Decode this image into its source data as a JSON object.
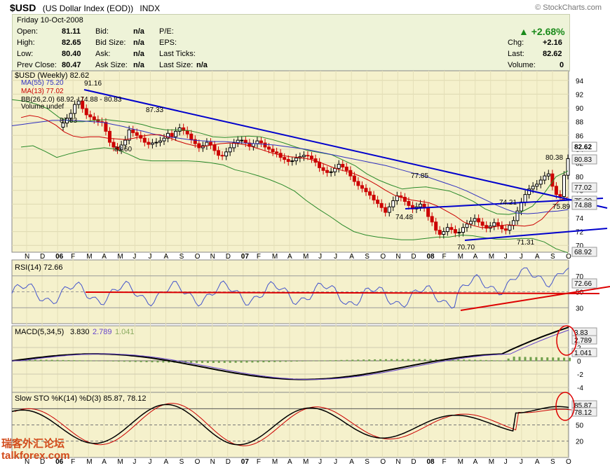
{
  "header": {
    "symbol": "$USD",
    "name": "(US Dollar Index (EOD))",
    "exchange": "INDX",
    "source": "© StockCharts.com"
  },
  "quote": {
    "date": "Friday  10-Oct-2008",
    "open_label": "Open:",
    "open": "81.11",
    "high_label": "High:",
    "high": "82.65",
    "low_label": "Low:",
    "low": "80.40",
    "prevclose_label": "Prev Close:",
    "prevclose": "80.47",
    "bid_label": "Bid:",
    "bid": "n/a",
    "bidsize_label": "Bid Size:",
    "bidsize": "n/a",
    "ask_label": "Ask:",
    "ask": "n/a",
    "asksize_label": "Ask Size:",
    "asksize": "n/a",
    "pe_label": "P/E:",
    "eps_label": "EPS:",
    "lastticks_label": "Last Ticks:",
    "lastsize_label": "Last Size:",
    "lastsize": "n/a",
    "pct": "+2.68%",
    "chg_label": "Chg:",
    "chg": "+2.16",
    "last_label": "Last:",
    "last": "82.62",
    "volume_label": "Volume:",
    "volume": "0"
  },
  "legend": {
    "price": "$USD (Weekly) 82.62",
    "ma55": "MA(55) 75.20",
    "ma13": "MA(13) 77.02",
    "bb": "BB(26,2.0) 68.92 - 74.88 - 80.83",
    "volume": "Volume undef",
    "rsi": "RSI(14) 72.66",
    "macd_prefix": "MACD(5,34,5)",
    "macd_a": "3.830",
    "macd_b": "2.789",
    "macd_c": "1.041",
    "sto": "Slow STO %K(14) %D(3) 85.87, 78.12"
  },
  "watermark": {
    "line1": "瑞客外汇论坛",
    "line2": "talkforex.com"
  },
  "colors": {
    "panel_bg": "#f5f1cc",
    "up": "#000000",
    "down": "#cc0000",
    "ma55": "#3030c0",
    "ma13": "#cc0000",
    "bb": "#2a8a2a",
    "trend": "#0000cc",
    "circle": "#dd0000"
  },
  "chart_data": [
    {
      "type": "candlestick",
      "title": "$USD (Weekly) 82.62",
      "x_months": [
        "N",
        "D",
        "06",
        "F",
        "M",
        "A",
        "M",
        "J",
        "J",
        "A",
        "S",
        "O",
        "N",
        "D",
        "07",
        "F",
        "M",
        "A",
        "M",
        "J",
        "J",
        "A",
        "S",
        "O",
        "N",
        "D",
        "08",
        "F",
        "M",
        "A",
        "M",
        "J",
        "J",
        "A",
        "S",
        "O"
      ],
      "y_ticks": [
        70,
        72,
        74,
        76,
        78,
        80,
        82,
        84,
        86,
        88,
        90,
        92,
        94
      ],
      "ylim": [
        69,
        95
      ],
      "annotations": [
        "91.16",
        "87.83",
        "87.33",
        "83.60",
        "77.85",
        "74.48",
        "74.21",
        "75.89",
        "80.38",
        "70.70",
        "71.31"
      ],
      "right_labels": [
        "82.62",
        "80.83",
        "77.02",
        "75.20",
        "74.88",
        "68.92"
      ],
      "close": [
        87.8,
        88.5,
        89.2,
        90.5,
        91.0,
        89.9,
        89.0,
        88.7,
        88.3,
        88.0,
        87.9,
        86.6,
        85.0,
        84.3,
        83.9,
        84.6,
        85.3,
        86.8,
        86.4,
        86.0,
        85.6,
        85.0,
        84.7,
        84.9,
        85.0,
        85.2,
        85.6,
        86.3,
        85.8,
        86.6,
        87.1,
        86.7,
        86.2,
        85.4,
        84.8,
        84.2,
        84.5,
        85.0,
        84.6,
        83.8,
        83.1,
        83.0,
        83.6,
        84.2,
        84.9,
        85.3,
        85.3,
        84.9,
        84.4,
        84.8,
        85.2,
        84.9,
        84.3,
        84.0,
        83.6,
        83.4,
        82.8,
        82.5,
        82.2,
        82.3,
        82.7,
        82.9,
        83.1,
        83.0,
        82.6,
        82.1,
        81.3,
        80.9,
        80.6,
        80.7,
        81.2,
        81.8,
        81.4,
        80.9,
        80.1,
        79.3,
        78.7,
        78.3,
        77.8,
        77.3,
        76.6,
        76.1,
        75.5,
        74.8,
        75.6,
        76.5,
        77.2,
        77.0,
        76.4,
        75.8,
        75.3,
        75.6,
        76.0,
        75.5,
        74.2,
        73.4,
        72.2,
        71.6,
        72.0,
        72.6,
        72.3,
        71.8,
        71.9,
        72.6,
        73.1,
        73.5,
        73.9,
        73.4,
        72.9,
        72.5,
        72.8,
        73.3,
        72.9,
        72.4,
        72.2,
        72.9,
        73.6,
        75.0,
        76.3,
        77.4,
        78.2,
        78.6,
        78.9,
        79.5,
        80.1,
        80.4,
        78.6,
        77.4,
        77.1,
        80.2,
        82.62
      ],
      "ma55": [
        87.4,
        87.6,
        87.8,
        88.0,
        88.2,
        88.2,
        88.2,
        88.1,
        88.0,
        87.9,
        87.6,
        87.3,
        86.9,
        86.6,
        86.2,
        85.9,
        85.7,
        85.5,
        85.3,
        85.2,
        85.1,
        85.1,
        85.0,
        84.9,
        84.8,
        84.7,
        84.6,
        84.4,
        84.2,
        84.0,
        83.7,
        83.4,
        83.1,
        82.8,
        82.5,
        82.2,
        81.9,
        81.6,
        81.2,
        80.8,
        80.4,
        80.0,
        79.5,
        79.0,
        78.5,
        77.9,
        77.2,
        76.5,
        75.8,
        75.2,
        74.7,
        74.6,
        74.7,
        74.9,
        75.0,
        75.2
      ],
      "ma13": [
        88.6,
        88.9,
        88.7,
        88.2,
        87.5,
        86.5,
        85.9,
        85.7,
        85.8,
        85.8,
        85.6,
        85.5,
        85.4,
        85.6,
        85.9,
        86.1,
        86.1,
        85.7,
        85.2,
        84.8,
        84.5,
        84.4,
        84.6,
        84.8,
        84.9,
        84.8,
        84.6,
        84.2,
        83.8,
        83.4,
        83.1,
        82.9,
        82.8,
        82.6,
        82.3,
        81.8,
        81.3,
        80.9,
        80.6,
        80.1,
        79.5,
        78.8,
        78.0,
        77.3,
        76.9,
        76.6,
        76.4,
        76.2,
        75.7,
        75.0,
        74.3,
        73.4,
        72.9,
        72.6,
        72.6,
        72.8,
        73.0,
        72.9,
        72.8,
        73.0,
        73.8,
        75.2,
        76.5,
        77.02
      ],
      "bb_upper": [
        91.2,
        91.0,
        90.6,
        89.9,
        88.6,
        88.0,
        88.0,
        88.2,
        88.3,
        88.1,
        87.9,
        87.6,
        87.1,
        86.8,
        86.8,
        86.7,
        86.3,
        85.8,
        85.7,
        85.8,
        85.9,
        85.8,
        85.4,
        84.9,
        84.3,
        83.8,
        83.5,
        83.2,
        82.4,
        81.6,
        80.4,
        79.5,
        78.8,
        78.2,
        78.4,
        78.5,
        78.2,
        77.9,
        77.2,
        76.4,
        75.3,
        74.6,
        74.5,
        74.8,
        75.7,
        77.6,
        80.0,
        80.83
      ],
      "bb_lower": [
        84.3,
        84.5,
        83.7,
        82.8,
        83.3,
        83.7,
        84.0,
        84.2,
        84.0,
        83.3,
        82.5,
        82.3,
        82.3,
        82.3,
        82.3,
        82.2,
        82.0,
        81.7,
        81.0,
        80.6,
        80.1,
        79.5,
        78.8,
        77.9,
        76.5,
        75.3,
        74.2,
        73.0,
        72.0,
        71.5,
        71.2,
        71.0,
        70.8,
        70.8,
        71.0,
        71.2,
        71.2,
        71.5,
        71.4,
        71.1,
        70.9,
        70.9,
        71.0,
        71.0,
        70.5,
        69.5,
        68.92
      ],
      "trendlines": "annotated"
    },
    {
      "type": "line",
      "title": "RSI(14) 72.66",
      "y_ticks": [
        30,
        50,
        70
      ],
      "ylim": [
        10,
        90
      ],
      "last": 72.66
    },
    {
      "type": "line",
      "title": "MACD(5,34,5)",
      "series": [
        {
          "name": "MACD",
          "last": 3.83
        },
        {
          "name": "Signal",
          "last": 2.789
        },
        {
          "name": "Histogram",
          "last": 1.041
        }
      ],
      "y_ticks": [
        -4,
        -2,
        0,
        2
      ],
      "ylim": [
        -5,
        5
      ]
    },
    {
      "type": "line",
      "title": "Slow STO %K(14) %D(3)",
      "series": [
        {
          "name": "%K",
          "last": 85.87
        },
        {
          "name": "%D",
          "last": 78.12
        }
      ],
      "y_ticks": [
        20,
        50
      ],
      "ylim": [
        0,
        100
      ]
    }
  ]
}
